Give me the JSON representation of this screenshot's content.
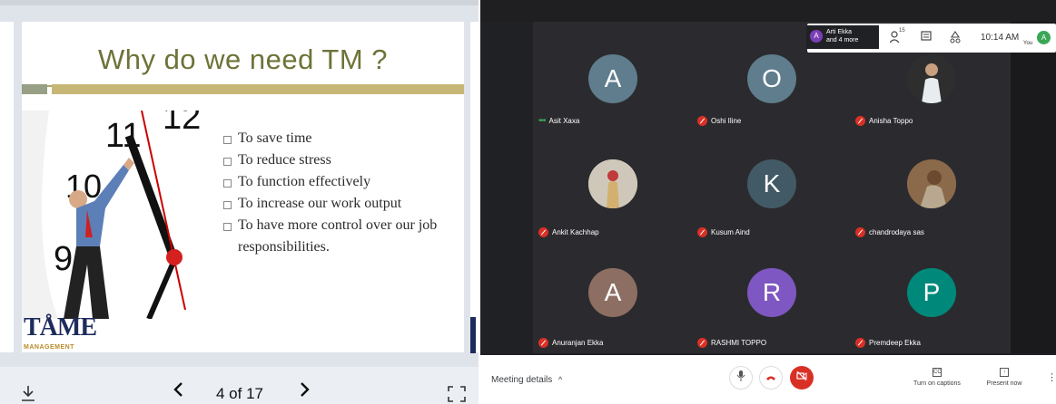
{
  "slide_viewer": {
    "slide": {
      "title": "Why do we need TM ?",
      "bullets": [
        "To save time",
        "To reduce stress",
        "To function effectively",
        "To increase our work output",
        "To have more control over our job responsibilities."
      ],
      "clock_numbers": [
        "11",
        "12",
        "10",
        "9"
      ],
      "logo_main": "TÅME",
      "logo_sub": "MANAGEMENT"
    },
    "page_indicator": "4 of 17",
    "icons": {
      "download": "download-icon",
      "prev": "chevron-left-icon",
      "next": "chevron-right-icon",
      "fullscreen": "fullscreen-icon"
    }
  },
  "meet": {
    "participants_chip": {
      "initial": "A",
      "line1": "Arti Ekka",
      "line2": "and 4 more"
    },
    "participant_count": "15",
    "clock": "10:14 AM",
    "self": {
      "initial": "A",
      "label": "You"
    },
    "tiles": [
      {
        "name": "Asit Xaxa",
        "initial": "A",
        "color": "#5f7d8c",
        "kind": "avatar",
        "status": "talking"
      },
      {
        "name": "Oshi Iline",
        "initial": "O",
        "color": "#5f7d8c",
        "kind": "avatar",
        "status": "muted"
      },
      {
        "name": "Anisha Toppo",
        "initial": "",
        "color": "#2a2a2a",
        "kind": "photo",
        "status": "muted"
      },
      {
        "name": "Ankit Kachhap",
        "initial": "",
        "color": "#c9c2b6",
        "kind": "photo",
        "status": "muted"
      },
      {
        "name": "Kusum Aind",
        "initial": "K",
        "color": "#425a66",
        "kind": "avatar",
        "status": "muted"
      },
      {
        "name": "chandrodaya sas",
        "initial": "",
        "color": "#7a5a3a",
        "kind": "photo",
        "status": "muted"
      },
      {
        "name": "Anuranjan Ekka",
        "initial": "A",
        "color": "#8d6e63",
        "kind": "avatar",
        "status": "muted"
      },
      {
        "name": "RASHMI TOPPO",
        "initial": "R",
        "color": "#7e57c2",
        "kind": "avatar",
        "status": "muted"
      },
      {
        "name": "Premdeep Ekka",
        "initial": "P",
        "color": "#00897b",
        "kind": "avatar",
        "status": "muted"
      }
    ],
    "bottom_bar": {
      "meeting_details": "Meeting details",
      "captions_label": "Turn on captions",
      "present_label": "Present now"
    },
    "colors": {
      "end_call": "#d93025",
      "mic_off": "#d93025",
      "accent": "#1a73e8"
    }
  }
}
